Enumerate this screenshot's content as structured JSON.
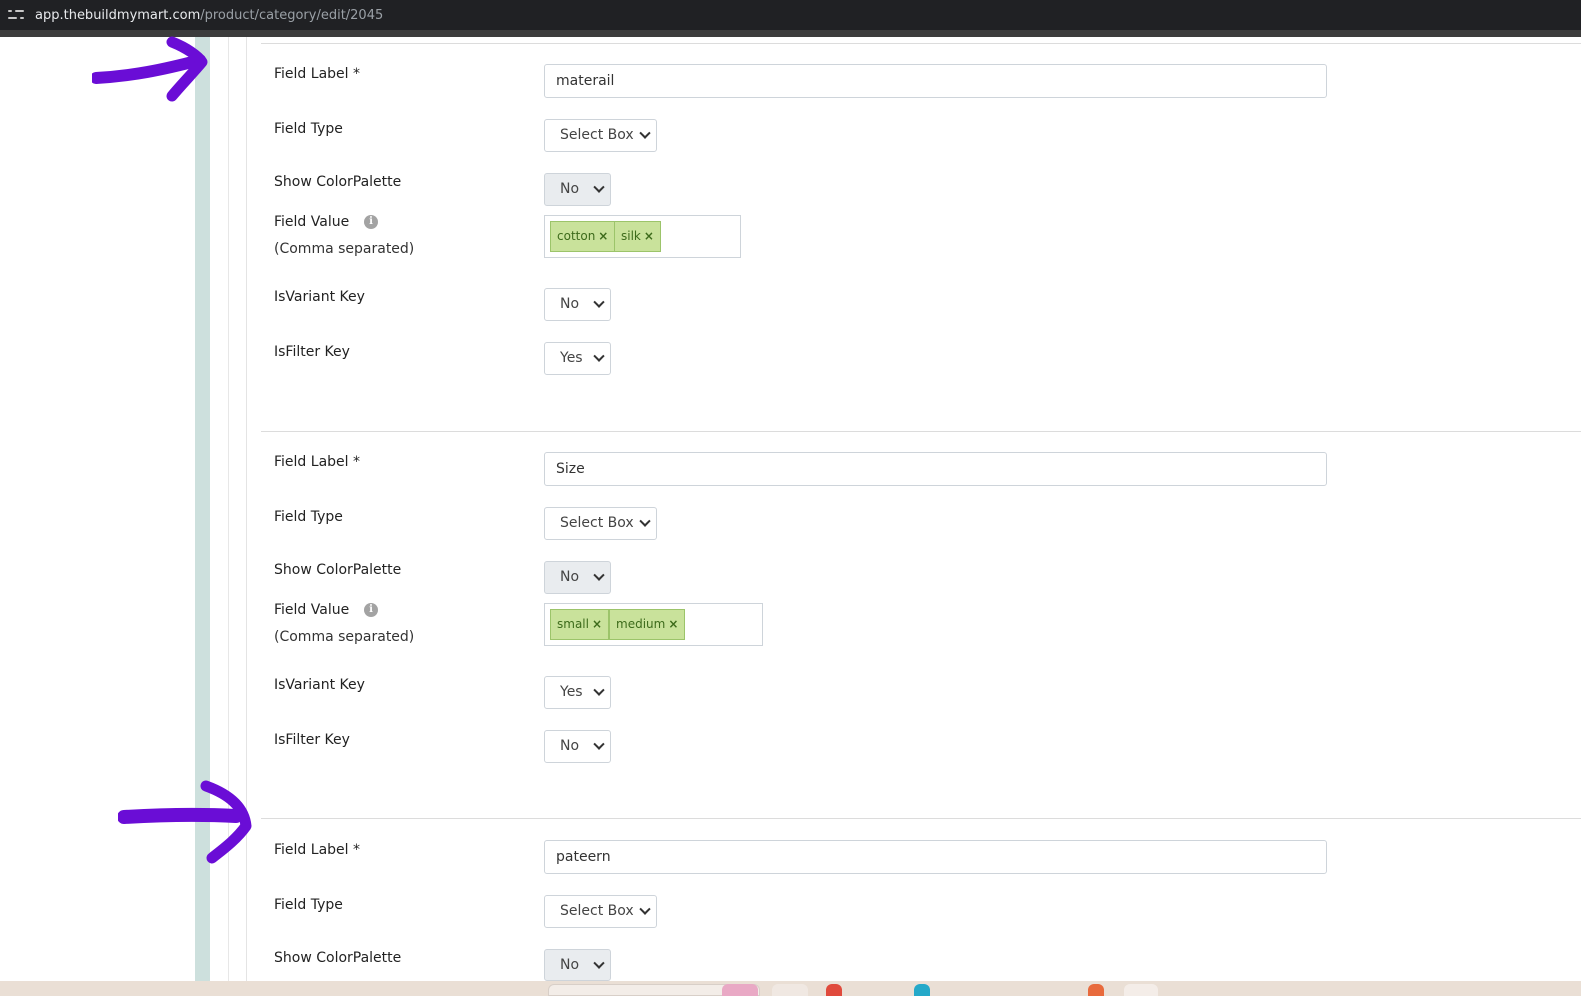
{
  "browser": {
    "url_host": "app.thebuildmymart.com",
    "url_path": "/product/category/edit/2045"
  },
  "labels": {
    "field_label": "Field Label *",
    "field_type": "Field Type",
    "show_color_palette": "Show ColorPalette",
    "field_value": "Field Value",
    "comma_separated": "(Comma separated)",
    "is_variant_key": "IsVariant Key",
    "is_filter_key": "IsFilter Key",
    "info_glyph": "i",
    "tag_remove": "×"
  },
  "fields": [
    {
      "label_value": "materail",
      "field_type": "Select Box",
      "show_color_palette": "No",
      "values": [
        "cotton",
        "silk"
      ],
      "is_variant_key": "No",
      "is_filter_key": "Yes"
    },
    {
      "label_value": "Size",
      "field_type": "Select Box",
      "show_color_palette": "No",
      "values": [
        "small",
        "medium"
      ],
      "is_variant_key": "Yes",
      "is_filter_key": "No"
    },
    {
      "label_value": "pateern",
      "field_type": "Select Box",
      "show_color_palette": "No"
    }
  ],
  "colors": {
    "annotation_arrow": "#6a0dd6",
    "tag_bg": "#c9e29b",
    "sidebar_strip": "#cde0dd"
  }
}
